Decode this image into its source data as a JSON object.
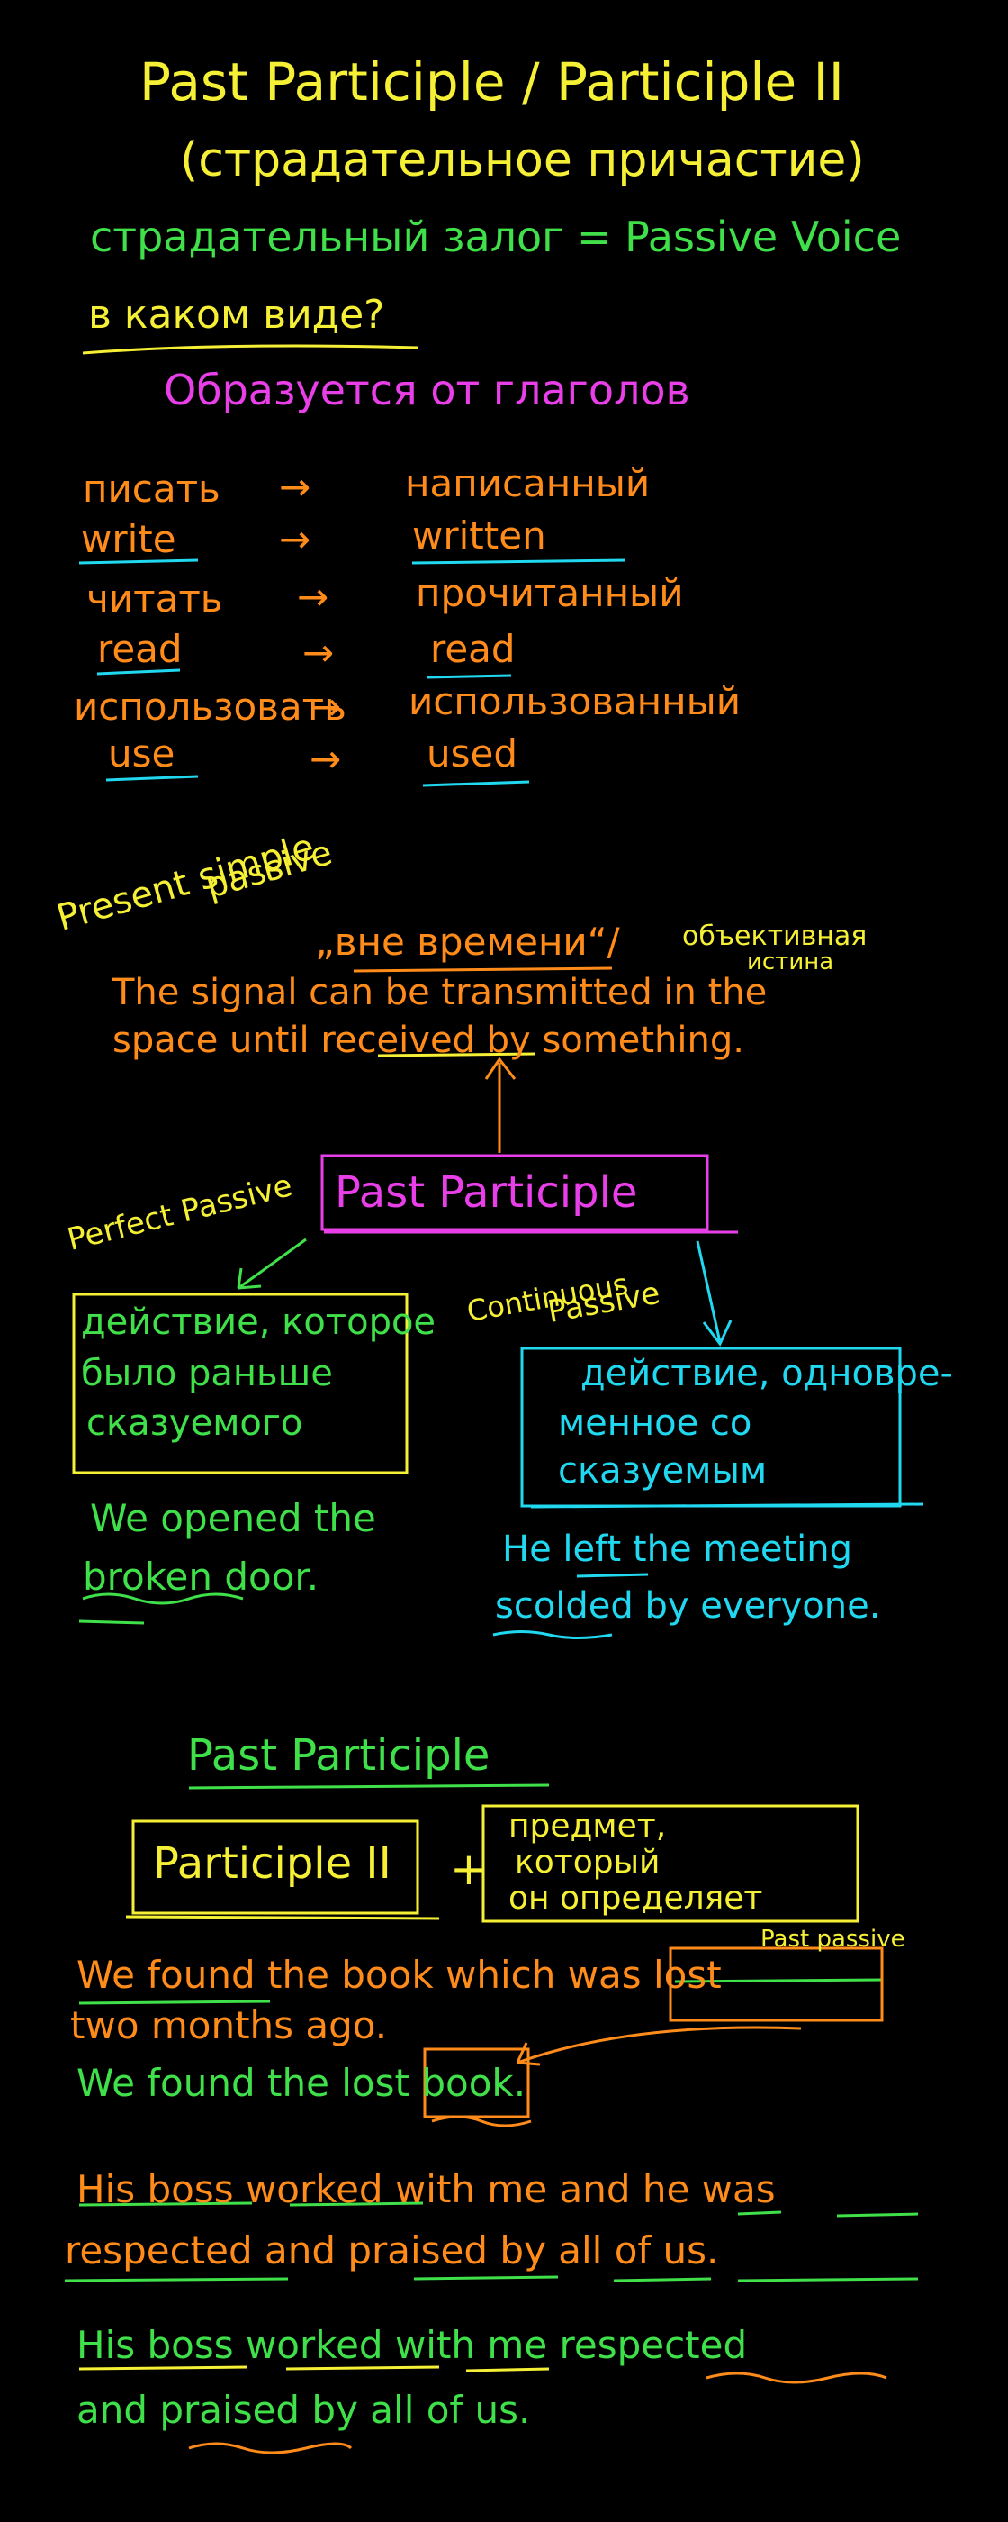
{
  "colors": {
    "background": "#000000",
    "yellow": "#f5f035",
    "green": "#3fe04a",
    "orange": "#ff8c1a",
    "magenta": "#e93fe8",
    "cyan": "#20d8f0"
  },
  "header": {
    "title": "Past Participle / Participle II",
    "subtitle": "(страдательное причастие)",
    "voice_line": "страдательный залог = Passive Voice",
    "question": "в каком виде?"
  },
  "formation": {
    "heading": "Образуется от глаголов",
    "rows": [
      {
        "left": "писать",
        "right": "написанный"
      },
      {
        "left": "write",
        "right": "written"
      },
      {
        "left": "читать",
        "right": "прочитанный"
      },
      {
        "left": "read",
        "right": "read"
      },
      {
        "left": "использовать",
        "right": "использованный"
      },
      {
        "left": "use",
        "right": "used"
      }
    ],
    "arrow": "→"
  },
  "present_simple": {
    "label_present": "Present simple",
    "label_passive": "passive",
    "quote": "„вне времени“/",
    "objective_1": "объективная",
    "objective_2": "истина",
    "sentence_1": "The signal can be transmitted in the",
    "sentence_2": "space until received by something."
  },
  "center": {
    "label": "Past Participle"
  },
  "perfect": {
    "label": "Perfect Passive",
    "box_lines": [
      "действие, которое",
      "было раньше",
      "сказуемого"
    ],
    "example_1": "We opened the",
    "example_2": "broken door."
  },
  "continuous": {
    "label_1": "Continuous",
    "label_2": "Passive",
    "box_lines": [
      "действие, одновре-",
      "менное со",
      "сказуемым"
    ],
    "example_1": "He left the meeting",
    "example_2": "scolded by everyone."
  },
  "section2": {
    "heading": "Past Participle",
    "participle_box": "Participle II",
    "plus": "+",
    "noun_box_lines": [
      "предмет,",
      "который",
      "он определяет"
    ],
    "past_passive_note": "Past passive",
    "ex1_line1": "We found the book which was lost",
    "ex1_line2": "two months ago.",
    "ex2": "We found the lost book.",
    "ex3_line1": "His boss worked with me and he was",
    "ex3_line2": "respected and praised by all of us.",
    "ex4_line1": "His boss worked with me respected",
    "ex4_line2": "and praised by all of us."
  }
}
